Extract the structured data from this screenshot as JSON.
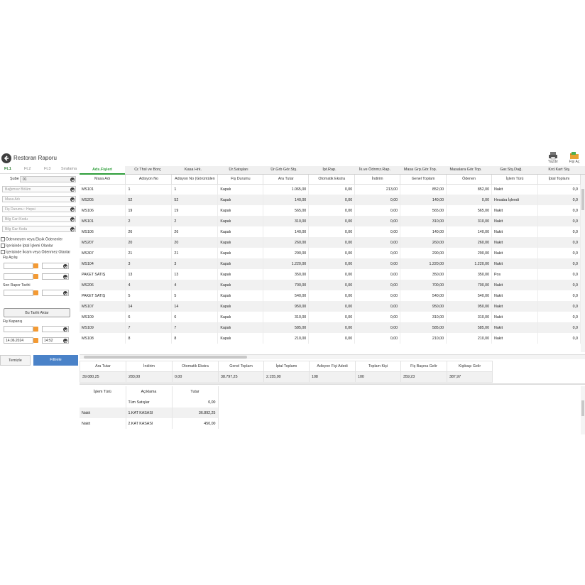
{
  "app": {
    "title": "Restoran Raporu",
    "toolbar": {
      "print_label": "Yazdır",
      "open_label": "Fişi Aç"
    }
  },
  "left": {
    "tabs": [
      "Ft.1",
      "Ft.2",
      "Ft.3",
      "Sıralama"
    ],
    "sube_label": "Şube",
    "sube_value": "01",
    "fields": [
      "Bağımsız Bölüm",
      "Masa Adı",
      "Fiş Durumu : Hepsi",
      "Bilg Cari Kodu",
      "Bilg Gar Kodu"
    ],
    "checkboxes": [
      "Ödenmeyen veya Eksik Ödenenler",
      "İçerisinde İptal İşlemi Olanlar",
      "İçerisinde İkram veya Ödenmez Olanlar"
    ],
    "fis_acilis_label": "Fiş Açılış",
    "son_rapor_label": "Son Rapor Tarihi",
    "bu_tarihi_label": "Bu Tarihi Aktar",
    "fis_kapanis_label": "Fiş Kapanış",
    "kapanis_date": "14.06.2024",
    "kapanis_time": "14:52",
    "temizle_label": "Temizle",
    "filtrele_label": "Filtrele"
  },
  "main": {
    "tabs": [
      "Ads.Fişleri",
      "Cr.Thsl ve Borç",
      "Kasa Hrk.",
      "Ür.Satışları",
      "Ür.Grb Gör.Stş.",
      "İpt.Rap.",
      "İk.ve Ödnmz.Rap.",
      "Masa Grp.Gör.Top.",
      "Masalara Gör.Top.",
      "Gar.Stş.Dağ.",
      "Krd.Kart Stş."
    ],
    "columns": [
      "Masa Adı",
      "Adisyon No",
      "Adisyon No (Görüntülen",
      "Fiş Durumu",
      "Ara Tutar",
      "Otomatik Ekstra",
      "İndirim",
      "Genel Toplam",
      "Ödenen",
      "İşlem Türü",
      "İptal Toplamı"
    ],
    "rows": [
      [
        "MS101",
        "1",
        "1",
        "Kapalı",
        "1.065,00",
        "0,00",
        "213,00",
        "852,00",
        "852,00",
        "Nakit",
        "0,0"
      ],
      [
        "MS205",
        "52",
        "52",
        "Kapalı",
        "140,00",
        "0,00",
        "0,00",
        "140,00",
        "0,00",
        "Hesaba İşlendi",
        "0,0"
      ],
      [
        "MS106",
        "19",
        "19",
        "Kapalı",
        "565,00",
        "0,00",
        "0,00",
        "565,00",
        "565,00",
        "Nakit",
        "0,0"
      ],
      [
        "MS101",
        "2",
        "2",
        "Kapalı",
        "310,00",
        "0,00",
        "0,00",
        "310,00",
        "310,00",
        "Nakit",
        "0,0"
      ],
      [
        "MS106",
        "26",
        "26",
        "Kapalı",
        "140,00",
        "0,00",
        "0,00",
        "140,00",
        "140,00",
        "Nakit",
        "0,0"
      ],
      [
        "MS207",
        "20",
        "20",
        "Kapalı",
        "260,00",
        "0,00",
        "0,00",
        "260,00",
        "260,00",
        "Nakit",
        "0,0"
      ],
      [
        "MS307",
        "21",
        "21",
        "Kapalı",
        "290,00",
        "0,00",
        "0,00",
        "290,00",
        "290,00",
        "Nakit",
        "0,0"
      ],
      [
        "MS104",
        "3",
        "3",
        "Kapalı",
        "1.220,00",
        "0,00",
        "0,00",
        "1.220,00",
        "1.220,00",
        "Nakit",
        "0,0"
      ],
      [
        "PAKET SATIŞ",
        "13",
        "13",
        "Kapalı",
        "350,00",
        "0,00",
        "0,00",
        "350,00",
        "350,00",
        "Pos",
        "0,0"
      ],
      [
        "MS206",
        "4",
        "4",
        "Kapalı",
        "700,00",
        "0,00",
        "0,00",
        "700,00",
        "700,00",
        "Nakit",
        "0,0"
      ],
      [
        "PAKET SATIŞ",
        "5",
        "5",
        "Kapalı",
        "540,00",
        "0,00",
        "0,00",
        "540,00",
        "540,00",
        "Nakit",
        "0,0"
      ],
      [
        "MS107",
        "14",
        "14",
        "Kapalı",
        "950,00",
        "0,00",
        "0,00",
        "950,00",
        "950,00",
        "Nakit",
        "0,0"
      ],
      [
        "MS109",
        "6",
        "6",
        "Kapalı",
        "310,00",
        "0,00",
        "0,00",
        "310,00",
        "310,00",
        "Nakit",
        "0,0"
      ],
      [
        "MS109",
        "7",
        "7",
        "Kapalı",
        "585,00",
        "0,00",
        "0,00",
        "585,00",
        "585,00",
        "Nakit",
        "0,0"
      ],
      [
        "MS108",
        "8",
        "8",
        "Kapalı",
        "210,00",
        "0,00",
        "0,00",
        "210,00",
        "210,00",
        "Nakit",
        "0,0"
      ]
    ]
  },
  "summary": {
    "headers": [
      "Ara Tutar",
      "İndirim",
      "Otomatik Ekstra",
      "Genel Toplam",
      "İptal Toplamı",
      "Adisyon Fişi Adedi",
      "Toplam Kişi",
      "Fiş Başına Gelir",
      "Kişibaşı Gelir"
    ],
    "values": [
      "39.080,25",
      "283,00",
      "0,00",
      "38.797,25",
      "2.155,00",
      "108",
      "100",
      "359,23",
      "387,97"
    ]
  },
  "bottom": {
    "headers": [
      "İşlem Türü",
      "Açıklama",
      "Tutar"
    ],
    "rows": [
      [
        "",
        "Tüm Satışlar",
        "0,00"
      ],
      [
        "Nakit",
        "1.KAT KASASI",
        "36.892,25"
      ],
      [
        "Nakit",
        "2.KAT KASASI",
        "450,00"
      ]
    ]
  },
  "colors": {
    "accent_green": "#2e9e3a",
    "filter_blue": "#4a82c8",
    "calendar_orange": "#f39a34"
  }
}
